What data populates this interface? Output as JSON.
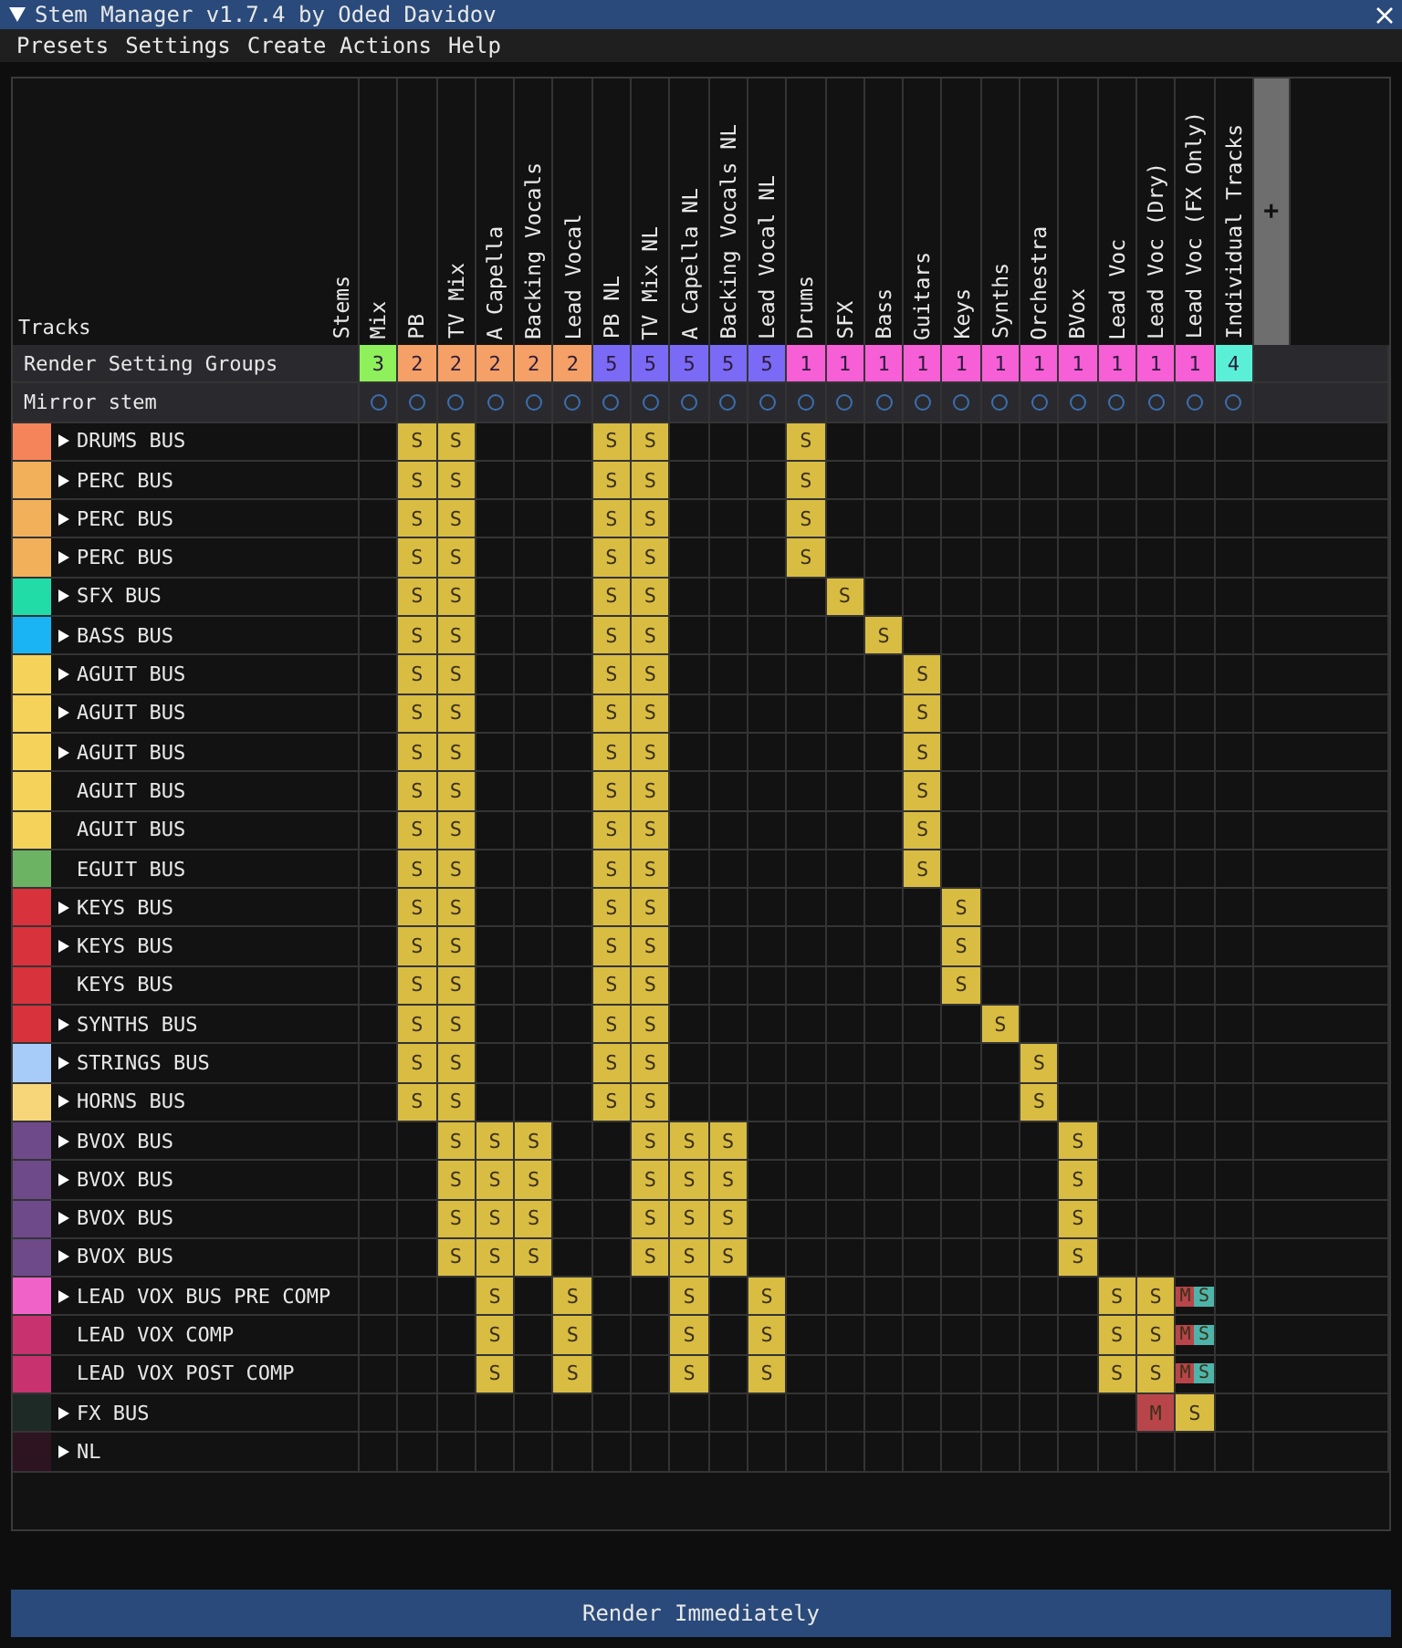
{
  "window": {
    "title": "Stem Manager v1.7.4 by Oded Davidov"
  },
  "menu": [
    "Presets",
    "Settings",
    "Create Actions",
    "Help"
  ],
  "header": {
    "tracks_label": "Tracks",
    "stems_label": "Stems",
    "add_button": "+",
    "groups_label": "Render Setting Groups",
    "mirror_label": "Mirror stem"
  },
  "stems": [
    {
      "name": "Mix",
      "group": "3",
      "color": "#8ef05a",
      "mirror": false
    },
    {
      "name": "PB",
      "group": "2",
      "color": "#f5a066",
      "mirror": false
    },
    {
      "name": "TV Mix",
      "group": "2",
      "color": "#f5a066",
      "mirror": false
    },
    {
      "name": "A Capella",
      "group": "2",
      "color": "#f5a066",
      "mirror": false
    },
    {
      "name": "Backing Vocals",
      "group": "2",
      "color": "#f5a066",
      "mirror": false
    },
    {
      "name": "Lead Vocal",
      "group": "2",
      "color": "#f5a066",
      "mirror": false
    },
    {
      "name": "PB NL",
      "group": "5",
      "color": "#7b6af5",
      "mirror": false
    },
    {
      "name": "TV Mix NL",
      "group": "5",
      "color": "#7b6af5",
      "mirror": false
    },
    {
      "name": "A Capella NL",
      "group": "5",
      "color": "#7b6af5",
      "mirror": false
    },
    {
      "name": "Backing Vocals NL",
      "group": "5",
      "color": "#7b6af5",
      "mirror": false
    },
    {
      "name": "Lead Vocal NL",
      "group": "5",
      "color": "#7b6af5",
      "mirror": false
    },
    {
      "name": "Drums",
      "group": "1",
      "color": "#f75fd6",
      "mirror": false
    },
    {
      "name": "SFX",
      "group": "1",
      "color": "#f75fd6",
      "mirror": false
    },
    {
      "name": "Bass",
      "group": "1",
      "color": "#f75fd6",
      "mirror": false
    },
    {
      "name": "Guitars",
      "group": "1",
      "color": "#f75fd6",
      "mirror": false
    },
    {
      "name": "Keys",
      "group": "1",
      "color": "#f75fd6",
      "mirror": false
    },
    {
      "name": "Synths",
      "group": "1",
      "color": "#f75fd6",
      "mirror": false
    },
    {
      "name": "Orchestra",
      "group": "1",
      "color": "#f75fd6",
      "mirror": false
    },
    {
      "name": "BVox",
      "group": "1",
      "color": "#f75fd6",
      "mirror": false
    },
    {
      "name": "Lead Voc",
      "group": "1",
      "color": "#f75fd6",
      "mirror": false
    },
    {
      "name": "Lead Voc (Dry)",
      "group": "1",
      "color": "#f75fd6",
      "mirror": false
    },
    {
      "name": "Lead Voc (FX Only)",
      "group": "1",
      "color": "#f75fd6",
      "mirror": false
    },
    {
      "name": "Individual Tracks",
      "group": "4",
      "color": "#5af0d8",
      "mirror": false
    }
  ],
  "tracks": [
    {
      "name": "DRUMS BUS",
      "color": "#f5845a",
      "expandable": true,
      "cells": [
        null,
        {
          "kind": "solo",
          "label": "S"
        },
        {
          "kind": "solo",
          "label": "S"
        },
        null,
        null,
        null,
        {
          "kind": "solo",
          "label": "S"
        },
        {
          "kind": "solo",
          "label": "S"
        },
        null,
        null,
        null,
        {
          "kind": "solo",
          "label": "S"
        },
        null,
        null,
        null,
        null,
        null,
        null,
        null,
        null,
        null,
        null,
        null
      ]
    },
    {
      "name": "PERC BUS",
      "color": "#f2b05a",
      "expandable": true,
      "cells": [
        null,
        {
          "kind": "solo",
          "label": "S"
        },
        {
          "kind": "solo",
          "label": "S"
        },
        null,
        null,
        null,
        {
          "kind": "solo",
          "label": "S"
        },
        {
          "kind": "solo",
          "label": "S"
        },
        null,
        null,
        null,
        {
          "kind": "solo",
          "label": "S"
        },
        null,
        null,
        null,
        null,
        null,
        null,
        null,
        null,
        null,
        null,
        null
      ]
    },
    {
      "name": "PERC BUS",
      "color": "#f2b05a",
      "expandable": true,
      "cells": [
        null,
        {
          "kind": "solo",
          "label": "S"
        },
        {
          "kind": "solo",
          "label": "S"
        },
        null,
        null,
        null,
        {
          "kind": "solo",
          "label": "S"
        },
        {
          "kind": "solo",
          "label": "S"
        },
        null,
        null,
        null,
        {
          "kind": "solo",
          "label": "S"
        },
        null,
        null,
        null,
        null,
        null,
        null,
        null,
        null,
        null,
        null,
        null
      ]
    },
    {
      "name": "PERC BUS",
      "color": "#f2b05a",
      "expandable": true,
      "cells": [
        null,
        {
          "kind": "solo",
          "label": "S"
        },
        {
          "kind": "solo",
          "label": "S"
        },
        null,
        null,
        null,
        {
          "kind": "solo",
          "label": "S"
        },
        {
          "kind": "solo",
          "label": "S"
        },
        null,
        null,
        null,
        {
          "kind": "solo",
          "label": "S"
        },
        null,
        null,
        null,
        null,
        null,
        null,
        null,
        null,
        null,
        null,
        null
      ]
    },
    {
      "name": "SFX BUS",
      "color": "#22dca8",
      "expandable": true,
      "cells": [
        null,
        {
          "kind": "solo",
          "label": "S"
        },
        {
          "kind": "solo",
          "label": "S"
        },
        null,
        null,
        null,
        {
          "kind": "solo",
          "label": "S"
        },
        {
          "kind": "solo",
          "label": "S"
        },
        null,
        null,
        null,
        null,
        {
          "kind": "solo",
          "label": "S"
        },
        null,
        null,
        null,
        null,
        null,
        null,
        null,
        null,
        null,
        null
      ]
    },
    {
      "name": "BASS BUS",
      "color": "#1ab4f5",
      "expandable": true,
      "cells": [
        null,
        {
          "kind": "solo",
          "label": "S"
        },
        {
          "kind": "solo",
          "label": "S"
        },
        null,
        null,
        null,
        {
          "kind": "solo",
          "label": "S"
        },
        {
          "kind": "solo",
          "label": "S"
        },
        null,
        null,
        null,
        null,
        null,
        {
          "kind": "solo",
          "label": "S"
        },
        null,
        null,
        null,
        null,
        null,
        null,
        null,
        null,
        null
      ]
    },
    {
      "name": "AGUIT BUS",
      "color": "#f5d25a",
      "expandable": true,
      "cells": [
        null,
        {
          "kind": "solo",
          "label": "S"
        },
        {
          "kind": "solo",
          "label": "S"
        },
        null,
        null,
        null,
        {
          "kind": "solo",
          "label": "S"
        },
        {
          "kind": "solo",
          "label": "S"
        },
        null,
        null,
        null,
        null,
        null,
        null,
        {
          "kind": "solo",
          "label": "S"
        },
        null,
        null,
        null,
        null,
        null,
        null,
        null,
        null
      ]
    },
    {
      "name": "AGUIT BUS",
      "color": "#f5d25a",
      "expandable": true,
      "cells": [
        null,
        {
          "kind": "solo",
          "label": "S"
        },
        {
          "kind": "solo",
          "label": "S"
        },
        null,
        null,
        null,
        {
          "kind": "solo",
          "label": "S"
        },
        {
          "kind": "solo",
          "label": "S"
        },
        null,
        null,
        null,
        null,
        null,
        null,
        {
          "kind": "solo",
          "label": "S"
        },
        null,
        null,
        null,
        null,
        null,
        null,
        null,
        null
      ]
    },
    {
      "name": "AGUIT BUS",
      "color": "#f5d25a",
      "expandable": true,
      "cells": [
        null,
        {
          "kind": "solo",
          "label": "S"
        },
        {
          "kind": "solo",
          "label": "S"
        },
        null,
        null,
        null,
        {
          "kind": "solo",
          "label": "S"
        },
        {
          "kind": "solo",
          "label": "S"
        },
        null,
        null,
        null,
        null,
        null,
        null,
        {
          "kind": "solo",
          "label": "S"
        },
        null,
        null,
        null,
        null,
        null,
        null,
        null,
        null
      ]
    },
    {
      "name": "AGUIT BUS",
      "color": "#f5d25a",
      "expandable": false,
      "cells": [
        null,
        {
          "kind": "solo",
          "label": "S"
        },
        {
          "kind": "solo",
          "label": "S"
        },
        null,
        null,
        null,
        {
          "kind": "solo",
          "label": "S"
        },
        {
          "kind": "solo",
          "label": "S"
        },
        null,
        null,
        null,
        null,
        null,
        null,
        {
          "kind": "solo",
          "label": "S"
        },
        null,
        null,
        null,
        null,
        null,
        null,
        null,
        null
      ]
    },
    {
      "name": "AGUIT BUS",
      "color": "#f5d25a",
      "expandable": false,
      "cells": [
        null,
        {
          "kind": "solo",
          "label": "S"
        },
        {
          "kind": "solo",
          "label": "S"
        },
        null,
        null,
        null,
        {
          "kind": "solo",
          "label": "S"
        },
        {
          "kind": "solo",
          "label": "S"
        },
        null,
        null,
        null,
        null,
        null,
        null,
        {
          "kind": "solo",
          "label": "S"
        },
        null,
        null,
        null,
        null,
        null,
        null,
        null,
        null
      ]
    },
    {
      "name": "EGUIT BUS",
      "color": "#6cb464",
      "expandable": false,
      "cells": [
        null,
        {
          "kind": "solo",
          "label": "S"
        },
        {
          "kind": "solo",
          "label": "S"
        },
        null,
        null,
        null,
        {
          "kind": "solo",
          "label": "S"
        },
        {
          "kind": "solo",
          "label": "S"
        },
        null,
        null,
        null,
        null,
        null,
        null,
        {
          "kind": "solo",
          "label": "S"
        },
        null,
        null,
        null,
        null,
        null,
        null,
        null,
        null
      ]
    },
    {
      "name": "KEYS BUS",
      "color": "#d8323c",
      "expandable": true,
      "cells": [
        null,
        {
          "kind": "solo",
          "label": "S"
        },
        {
          "kind": "solo",
          "label": "S"
        },
        null,
        null,
        null,
        {
          "kind": "solo",
          "label": "S"
        },
        {
          "kind": "solo",
          "label": "S"
        },
        null,
        null,
        null,
        null,
        null,
        null,
        null,
        {
          "kind": "solo",
          "label": "S"
        },
        null,
        null,
        null,
        null,
        null,
        null,
        null
      ]
    },
    {
      "name": "KEYS BUS",
      "color": "#d8323c",
      "expandable": true,
      "cells": [
        null,
        {
          "kind": "solo",
          "label": "S"
        },
        {
          "kind": "solo",
          "label": "S"
        },
        null,
        null,
        null,
        {
          "kind": "solo",
          "label": "S"
        },
        {
          "kind": "solo",
          "label": "S"
        },
        null,
        null,
        null,
        null,
        null,
        null,
        null,
        {
          "kind": "solo",
          "label": "S"
        },
        null,
        null,
        null,
        null,
        null,
        null,
        null
      ]
    },
    {
      "name": "KEYS BUS",
      "color": "#d8323c",
      "expandable": false,
      "cells": [
        null,
        {
          "kind": "solo",
          "label": "S"
        },
        {
          "kind": "solo",
          "label": "S"
        },
        null,
        null,
        null,
        {
          "kind": "solo",
          "label": "S"
        },
        {
          "kind": "solo",
          "label": "S"
        },
        null,
        null,
        null,
        null,
        null,
        null,
        null,
        {
          "kind": "solo",
          "label": "S"
        },
        null,
        null,
        null,
        null,
        null,
        null,
        null
      ]
    },
    {
      "name": "SYNTHS BUS",
      "color": "#d8323c",
      "expandable": true,
      "cells": [
        null,
        {
          "kind": "solo",
          "label": "S"
        },
        {
          "kind": "solo",
          "label": "S"
        },
        null,
        null,
        null,
        {
          "kind": "solo",
          "label": "S"
        },
        {
          "kind": "solo",
          "label": "S"
        },
        null,
        null,
        null,
        null,
        null,
        null,
        null,
        null,
        {
          "kind": "solo",
          "label": "S"
        },
        null,
        null,
        null,
        null,
        null,
        null
      ]
    },
    {
      "name": "STRINGS BUS",
      "color": "#a8ccfa",
      "expandable": true,
      "cells": [
        null,
        {
          "kind": "solo",
          "label": "S"
        },
        {
          "kind": "solo",
          "label": "S"
        },
        null,
        null,
        null,
        {
          "kind": "solo",
          "label": "S"
        },
        {
          "kind": "solo",
          "label": "S"
        },
        null,
        null,
        null,
        null,
        null,
        null,
        null,
        null,
        null,
        {
          "kind": "solo",
          "label": "S"
        },
        null,
        null,
        null,
        null,
        null
      ]
    },
    {
      "name": "HORNS BUS",
      "color": "#f7d67a",
      "expandable": true,
      "cells": [
        null,
        {
          "kind": "solo",
          "label": "S"
        },
        {
          "kind": "solo",
          "label": "S"
        },
        null,
        null,
        null,
        {
          "kind": "solo",
          "label": "S"
        },
        {
          "kind": "solo",
          "label": "S"
        },
        null,
        null,
        null,
        null,
        null,
        null,
        null,
        null,
        null,
        {
          "kind": "solo",
          "label": "S"
        },
        null,
        null,
        null,
        null,
        null
      ]
    },
    {
      "name": "BVOX BUS",
      "color": "#6e4a8a",
      "expandable": true,
      "cells": [
        null,
        null,
        {
          "kind": "solo",
          "label": "S"
        },
        {
          "kind": "solo",
          "label": "S"
        },
        {
          "kind": "solo",
          "label": "S"
        },
        null,
        null,
        {
          "kind": "solo",
          "label": "S"
        },
        {
          "kind": "solo",
          "label": "S"
        },
        {
          "kind": "solo",
          "label": "S"
        },
        null,
        null,
        null,
        null,
        null,
        null,
        null,
        null,
        {
          "kind": "solo",
          "label": "S"
        },
        null,
        null,
        null,
        null
      ]
    },
    {
      "name": "BVOX BUS",
      "color": "#6e4a8a",
      "expandable": true,
      "cells": [
        null,
        null,
        {
          "kind": "solo",
          "label": "S"
        },
        {
          "kind": "solo",
          "label": "S"
        },
        {
          "kind": "solo",
          "label": "S"
        },
        null,
        null,
        {
          "kind": "solo",
          "label": "S"
        },
        {
          "kind": "solo",
          "label": "S"
        },
        {
          "kind": "solo",
          "label": "S"
        },
        null,
        null,
        null,
        null,
        null,
        null,
        null,
        null,
        {
          "kind": "solo",
          "label": "S"
        },
        null,
        null,
        null,
        null
      ]
    },
    {
      "name": "BVOX BUS",
      "color": "#6e4a8a",
      "expandable": true,
      "cells": [
        null,
        null,
        {
          "kind": "solo",
          "label": "S"
        },
        {
          "kind": "solo",
          "label": "S"
        },
        {
          "kind": "solo",
          "label": "S"
        },
        null,
        null,
        {
          "kind": "solo",
          "label": "S"
        },
        {
          "kind": "solo",
          "label": "S"
        },
        {
          "kind": "solo",
          "label": "S"
        },
        null,
        null,
        null,
        null,
        null,
        null,
        null,
        null,
        {
          "kind": "solo",
          "label": "S"
        },
        null,
        null,
        null,
        null
      ]
    },
    {
      "name": "BVOX BUS",
      "color": "#6e4a8a",
      "expandable": true,
      "cells": [
        null,
        null,
        {
          "kind": "solo",
          "label": "S"
        },
        {
          "kind": "solo",
          "label": "S"
        },
        {
          "kind": "solo",
          "label": "S"
        },
        null,
        null,
        {
          "kind": "solo",
          "label": "S"
        },
        {
          "kind": "solo",
          "label": "S"
        },
        {
          "kind": "solo",
          "label": "S"
        },
        null,
        null,
        null,
        null,
        null,
        null,
        null,
        null,
        {
          "kind": "solo",
          "label": "S"
        },
        null,
        null,
        null,
        null
      ]
    },
    {
      "name": "LEAD VOX BUS PRE COMP",
      "color": "#f062c8",
      "expandable": true,
      "cells": [
        null,
        null,
        null,
        {
          "kind": "solo",
          "label": "S"
        },
        null,
        {
          "kind": "solo",
          "label": "S"
        },
        null,
        null,
        {
          "kind": "solo",
          "label": "S"
        },
        null,
        {
          "kind": "solo",
          "label": "S"
        },
        null,
        null,
        null,
        null,
        null,
        null,
        null,
        null,
        {
          "kind": "solo",
          "label": "S"
        },
        {
          "kind": "solo",
          "label": "S"
        },
        {
          "kind": "mute_solo",
          "mute": "M",
          "solo": "S"
        },
        null
      ]
    },
    {
      "name": "LEAD VOX COMP",
      "color": "#c8326e",
      "expandable": false,
      "cells": [
        null,
        null,
        null,
        {
          "kind": "solo",
          "label": "S"
        },
        null,
        {
          "kind": "solo",
          "label": "S"
        },
        null,
        null,
        {
          "kind": "solo",
          "label": "S"
        },
        null,
        {
          "kind": "solo",
          "label": "S"
        },
        null,
        null,
        null,
        null,
        null,
        null,
        null,
        null,
        {
          "kind": "solo",
          "label": "S"
        },
        {
          "kind": "solo",
          "label": "S"
        },
        {
          "kind": "mute_solo",
          "mute": "M",
          "solo": "S"
        },
        null
      ]
    },
    {
      "name": "LEAD VOX POST COMP",
      "color": "#c8326e",
      "expandable": false,
      "cells": [
        null,
        null,
        null,
        {
          "kind": "solo",
          "label": "S"
        },
        null,
        {
          "kind": "solo",
          "label": "S"
        },
        null,
        null,
        {
          "kind": "solo",
          "label": "S"
        },
        null,
        {
          "kind": "solo",
          "label": "S"
        },
        null,
        null,
        null,
        null,
        null,
        null,
        null,
        null,
        {
          "kind": "solo",
          "label": "S"
        },
        {
          "kind": "solo",
          "label": "S"
        },
        {
          "kind": "mute_solo",
          "mute": "M",
          "solo": "S"
        },
        null
      ]
    },
    {
      "name": "FX BUS",
      "color": "#1e2a26",
      "expandable": true,
      "cells": [
        null,
        null,
        null,
        null,
        null,
        null,
        null,
        null,
        null,
        null,
        null,
        null,
        null,
        null,
        null,
        null,
        null,
        null,
        null,
        null,
        {
          "kind": "mute",
          "label": "M"
        },
        {
          "kind": "solo",
          "label": "S"
        },
        null
      ]
    },
    {
      "name": "NL",
      "color": "#2e1420",
      "expandable": true,
      "cells": [
        null,
        null,
        null,
        null,
        null,
        null,
        null,
        null,
        null,
        null,
        null,
        null,
        null,
        null,
        null,
        null,
        null,
        null,
        null,
        null,
        null,
        null,
        null
      ]
    }
  ],
  "render_button": "Render Immediately"
}
